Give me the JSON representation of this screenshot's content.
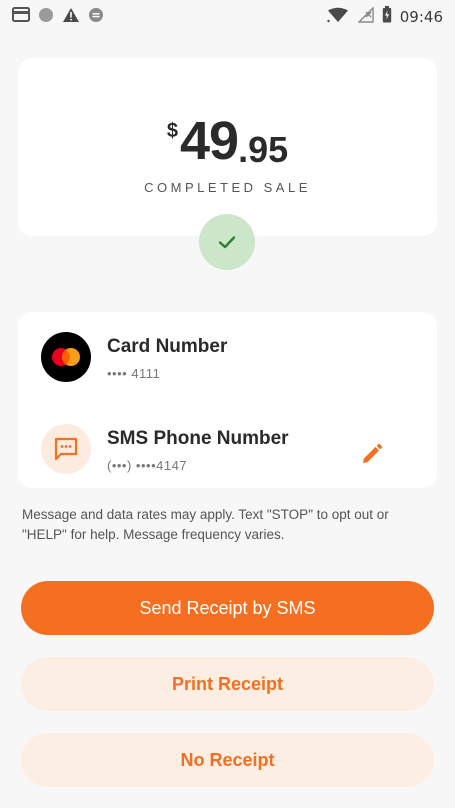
{
  "status_bar": {
    "time": "09:46",
    "left_icons": [
      "card-icon",
      "circle-icon",
      "warning-icon",
      "media-icon"
    ],
    "right_icons": [
      "wifi-icon",
      "no-signal-icon",
      "battery-icon"
    ]
  },
  "sale": {
    "currency": "$",
    "amount_whole": "49",
    "amount_cents": ".95",
    "status": "COMPLETED SALE"
  },
  "details": {
    "card_label": "Card Number",
    "card_value": "•••• 4111",
    "sms_label": "SMS Phone Number",
    "sms_value": "(•••) ••••4147"
  },
  "disclaimer": "Message and data rates may apply. Text \"STOP\" to opt out or \"HELP\" for help. Message frequency varies.",
  "buttons": {
    "send_sms": "Send Receipt by SMS",
    "print": "Print Receipt",
    "none": "No Receipt"
  },
  "colors": {
    "accent": "#f46f20",
    "accent_light": "#fdeee4",
    "success_bg": "#cbe6c8",
    "success_icon": "#2e7d32"
  }
}
